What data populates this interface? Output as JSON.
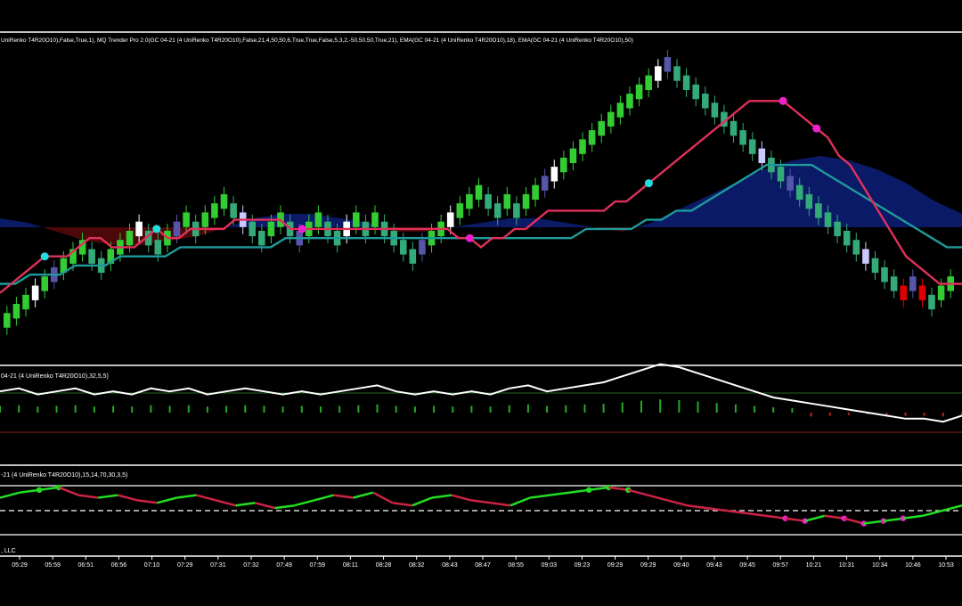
{
  "header": {
    "indicator_text": "UniRenko T4R20O10),False,True,1), MQ Trender Pro 2.0(GC 04-21 (4 UniRenko T4R20O10),False,21,4,50,50,6,True,True,False,5,3,2,-50,50,50,True,21), EMA(GC 04-21 (4 UniRenko T4R20O10),18), EMA(GC 04-21 (4 UniRenko T4R20O10),50)"
  },
  "panels": {
    "macd_label": "04-21 (4 UniRenko T4R20O10),32,5,5)",
    "rsi_label": "-21 (4 UniRenko T4R20O10),15,14,70,30,3,5)",
    "footer_label": ", LLC"
  },
  "colors": {
    "bull_bar": "#33cc33",
    "bear_bar": "#33aa77",
    "weak_bull": "#ffffff",
    "weak_bear": "#c9c9ff",
    "neutral_bar": "#5555aa",
    "ema_fast": "#e0305a",
    "ema_slow": "#1e9a9a",
    "cloud_up": "#0a1a66",
    "cloud_down": "#4a0808",
    "rsi_up": "#22dd22",
    "rsi_down": "#cc2244",
    "signal_cyan": "#22dddd",
    "signal_magenta": "#ee22cc"
  },
  "chart_data": {
    "type": "candlestick",
    "x_tick_labels": [
      "05:29",
      "05:59",
      "06:51",
      "06:56",
      "07:10",
      "07:29",
      "07:31",
      "07:32",
      "07:49",
      "07:59",
      "08:11",
      "08:28",
      "08:32",
      "08:43",
      "08:47",
      "08:55",
      "09:03",
      "09:23",
      "09:29",
      "09:29",
      "09:40",
      "09:43",
      "09:45",
      "09:57",
      "10:21",
      "10:31",
      "10:34",
      "10:46",
      "10:53"
    ],
    "price_series": [
      2,
      3,
      4,
      5,
      6,
      7,
      8,
      9,
      10,
      9,
      8,
      9,
      10,
      11,
      12,
      11,
      10,
      11,
      12,
      13,
      12,
      13,
      14,
      15,
      14,
      13,
      12,
      11,
      12,
      13,
      12,
      11,
      12,
      13,
      12,
      11,
      12,
      13,
      12,
      13,
      12,
      11,
      10,
      9,
      10,
      11,
      12,
      13,
      14,
      15,
      16,
      15,
      14,
      15,
      14,
      15,
      16,
      17,
      18,
      19,
      20,
      21,
      22,
      23,
      24,
      25,
      26,
      27,
      28,
      29,
      30,
      29,
      28,
      27,
      26,
      25,
      24,
      23,
      22,
      21,
      20,
      19,
      18,
      17,
      16,
      15,
      14,
      13,
      12,
      11,
      10,
      9,
      8,
      7,
      6,
      5,
      6,
      5,
      4,
      5,
      6
    ],
    "ema_fast_series": [
      5,
      6,
      7,
      8,
      9,
      9,
      9,
      10,
      11,
      11,
      10,
      10,
      10,
      11,
      12,
      11,
      11,
      12,
      12,
      12,
      12,
      13,
      13,
      13,
      13,
      13,
      12,
      12,
      12,
      12,
      12,
      12,
      12,
      12,
      12,
      12,
      12,
      12,
      12,
      12,
      12,
      11,
      11,
      10,
      11,
      11,
      12,
      12,
      13,
      14,
      14,
      14,
      14,
      14,
      14,
      15,
      15,
      16,
      17,
      18,
      19,
      20,
      21,
      22,
      23,
      24,
      25,
      26,
      26,
      26,
      26,
      25,
      24,
      23,
      22,
      20,
      19,
      17,
      15,
      13,
      11,
      9,
      8,
      7,
      6,
      6,
      6
    ],
    "ema_slow_series": [
      6,
      6,
      7,
      7,
      7,
      8,
      8,
      8,
      9,
      9,
      9,
      9,
      10,
      10,
      10,
      10,
      10,
      10,
      10,
      11,
      11,
      11,
      11,
      11,
      11,
      11,
      11,
      11,
      11,
      11,
      11,
      11,
      11,
      11,
      11,
      11,
      11,
      11,
      11,
      12,
      12,
      12,
      12,
      13,
      13,
      14,
      14,
      15,
      16,
      17,
      18,
      19,
      19,
      19,
      19,
      18,
      17,
      16,
      15,
      14,
      13,
      12,
      11,
      10,
      10
    ],
    "cloud_series": [
      2,
      1,
      -1,
      -3,
      -4,
      -4,
      -3,
      -2,
      0,
      2,
      3,
      3,
      2,
      1,
      -1,
      -1,
      0,
      1,
      2,
      2,
      1,
      0,
      -1,
      1,
      4,
      7,
      10,
      13,
      15,
      16,
      15,
      13,
      10,
      6,
      3
    ],
    "macd_series": [
      7,
      8,
      6,
      7,
      8,
      6,
      7,
      6,
      8,
      7,
      8,
      6,
      7,
      8,
      7,
      6,
      7,
      6,
      7,
      8,
      9,
      7,
      6,
      7,
      6,
      7,
      6,
      8,
      9,
      7,
      8,
      9,
      10,
      12,
      14,
      16,
      15,
      13,
      11,
      9,
      7,
      5,
      4,
      3,
      2,
      1,
      0,
      -1,
      -2,
      -2,
      -3,
      -1
    ],
    "rsi_series": [
      5,
      7,
      8,
      9,
      6,
      5,
      6,
      4,
      3,
      5,
      6,
      4,
      2,
      3,
      1,
      2,
      4,
      6,
      5,
      7,
      3,
      2,
      5,
      6,
      4,
      3,
      2,
      5,
      6,
      7,
      8,
      9,
      8,
      6,
      4,
      2,
      1,
      0,
      -1,
      -2,
      -3,
      -4,
      -2,
      -3,
      -5,
      -4,
      -3,
      -2,
      0,
      2
    ],
    "ylim": [
      0,
      31
    ]
  }
}
